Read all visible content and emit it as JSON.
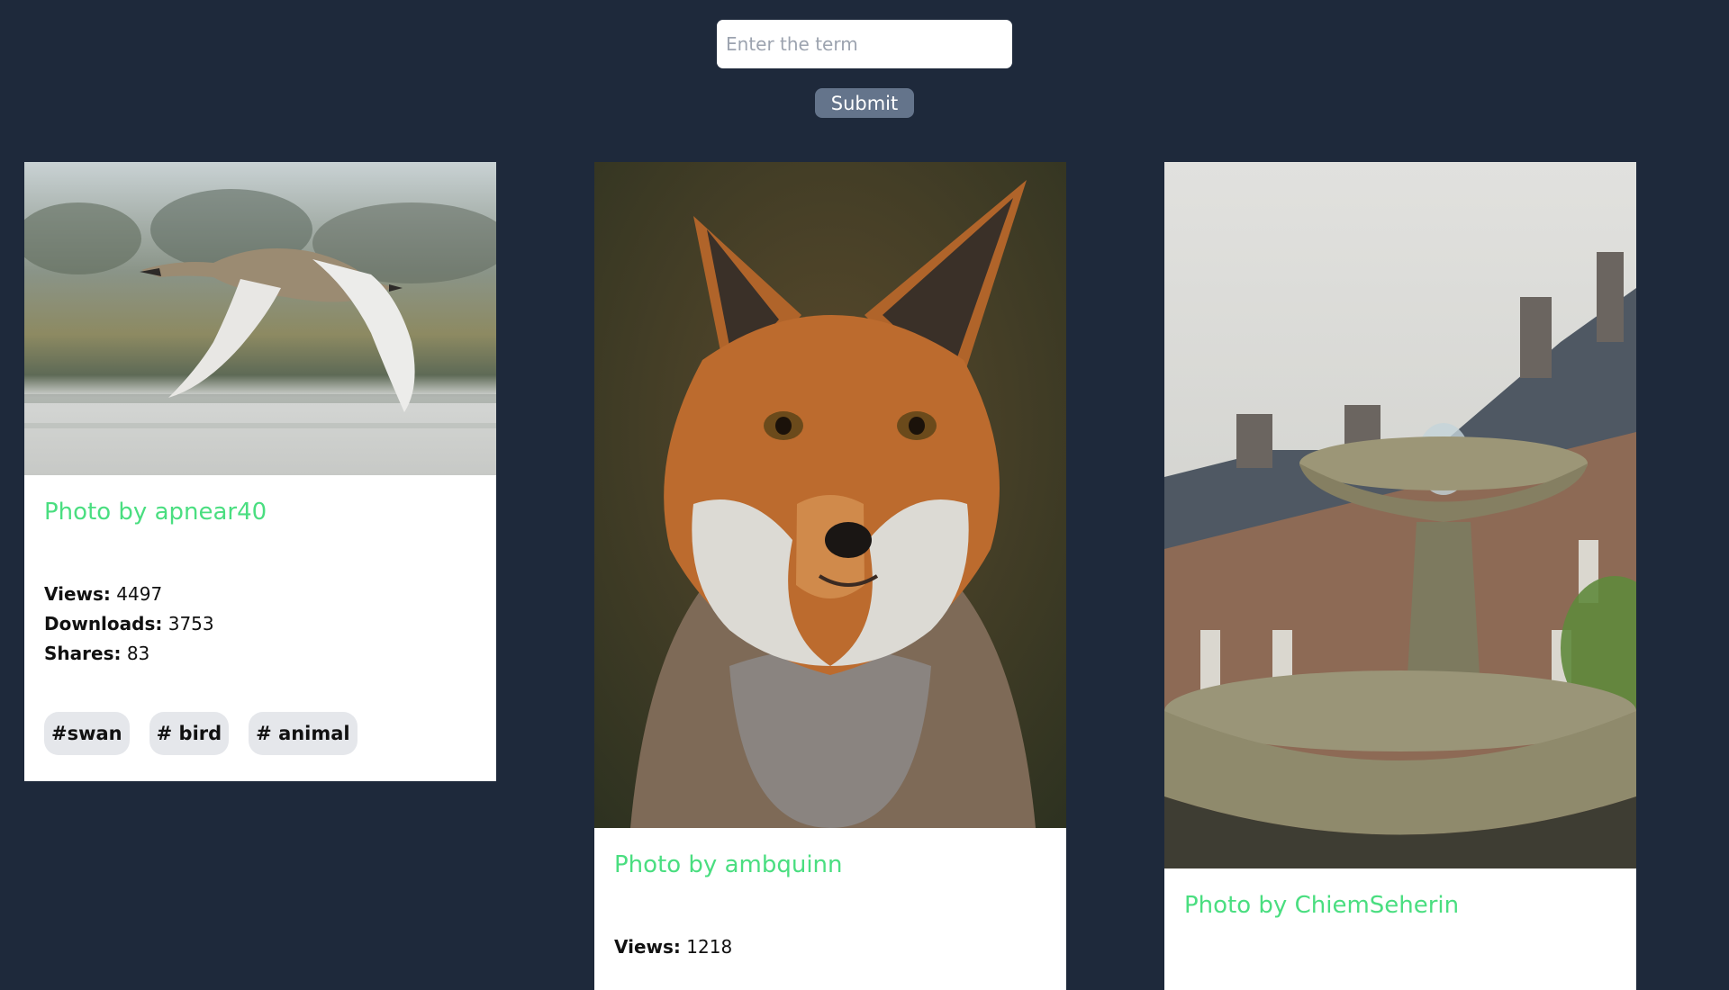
{
  "search": {
    "placeholder": "Enter the term",
    "value": "",
    "submit_label": "Submit"
  },
  "cards": [
    {
      "author": "Photo by apnear40",
      "image_subject": "swan",
      "stats": [
        {
          "label": "Views:",
          "value": "4497"
        },
        {
          "label": "Downloads:",
          "value": "3753"
        },
        {
          "label": "Shares:",
          "value": "83"
        }
      ],
      "tags": [
        "#swan",
        "# bird",
        "# animal"
      ]
    },
    {
      "author": "Photo by ambquinn",
      "image_subject": "fox",
      "stats": [
        {
          "label": "Views:",
          "value": "1218"
        }
      ]
    },
    {
      "author": "Photo by ChiemSeherin",
      "image_subject": "fountain"
    }
  ],
  "colors": {
    "background": "#1e293b",
    "accent_author": "#4ade80",
    "submit_button": "#64748b",
    "tag_background": "#e5e7eb"
  }
}
